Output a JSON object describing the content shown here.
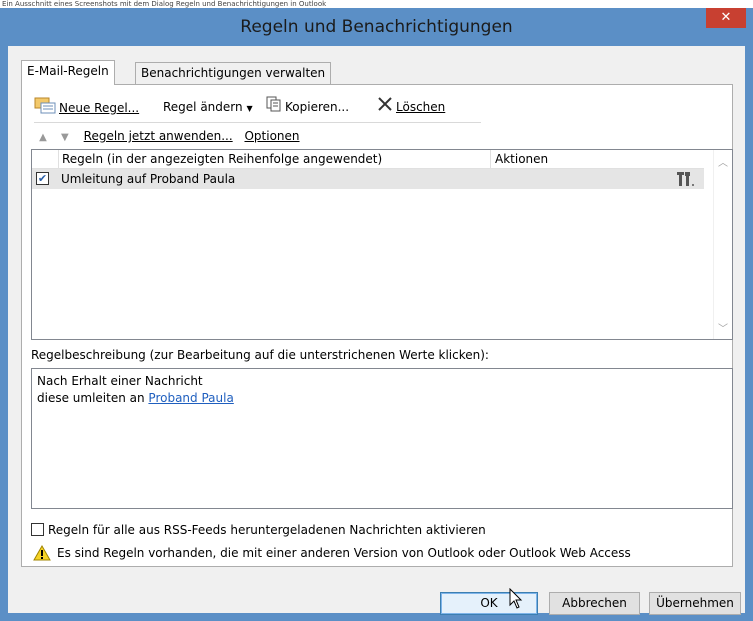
{
  "top_caption": "Ein Ausschnitt eines Screenshots mit dem Dialog Regeln und Benachrichtigungen in Outlook",
  "window": {
    "title": "Regeln und Benachrichtigungen",
    "close_glyph": "✕"
  },
  "tabs": [
    {
      "label": "E-Mail-Regeln",
      "active": true
    },
    {
      "label": "Benachrichtigungen verwalten",
      "active": false
    }
  ],
  "toolbar": {
    "new_rule": "Neue Regel...",
    "change_rule": "Regel ändern",
    "copy": "Kopieren...",
    "delete": "Löschen"
  },
  "row2": {
    "apply_now": "Regeln jetzt anwenden...",
    "options": "Optionen"
  },
  "rules_list": {
    "headers": [
      "Regeln (in der angezeigten Reihenfolge angewendet)",
      "Aktionen"
    ],
    "rows": [
      {
        "checked": true,
        "name": "Umleitung auf Proband Paula",
        "action_icon": "tools-icon"
      }
    ]
  },
  "description": {
    "label": "Regelbeschreibung (zur Bearbeitung auf die unterstrichenen Werte klicken):",
    "line1": "Nach Erhalt einer Nachricht",
    "line2_prefix": "diese umleiten an ",
    "line2_link": "Proband Paula"
  },
  "rss_label": "Regeln für alle aus RSS-Feeds heruntergeladenen Nachrichten aktivieren",
  "warning": "Es sind Regeln vorhanden, die mit einer anderen Version von Outlook oder Outlook Web Access",
  "buttons": {
    "ok": "OK",
    "cancel": "Abbrechen",
    "apply": "Übernehmen"
  }
}
